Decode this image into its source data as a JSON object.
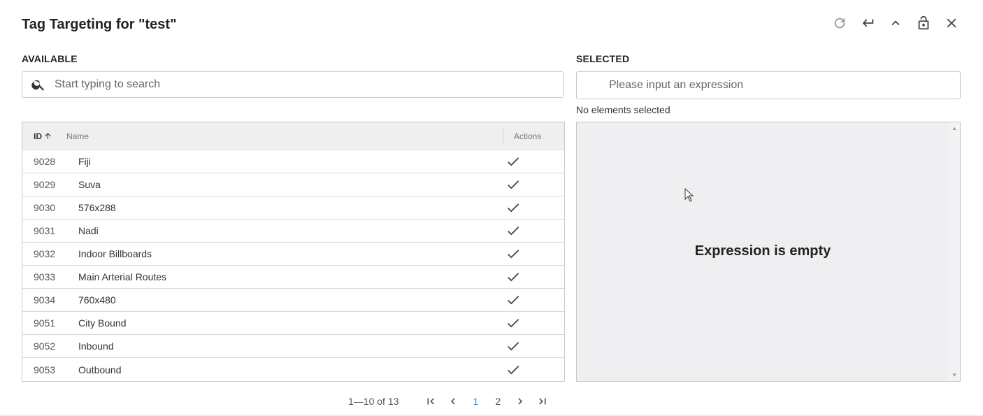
{
  "dialog": {
    "title": "Tag Targeting for \"test\""
  },
  "header_icons": [
    "refresh-icon",
    "enter-icon",
    "collapse-icon",
    "unlock-icon",
    "close-icon"
  ],
  "available": {
    "label": "AVAILABLE",
    "search_placeholder": "Start typing to search",
    "columns": {
      "id": "ID",
      "name": "Name",
      "actions": "Actions"
    },
    "rows": [
      {
        "id": "9028",
        "name": "Fiji"
      },
      {
        "id": "9029",
        "name": "Suva"
      },
      {
        "id": "9030",
        "name": "576x288"
      },
      {
        "id": "9031",
        "name": "Nadi"
      },
      {
        "id": "9032",
        "name": "Indoor Billboards"
      },
      {
        "id": "9033",
        "name": "Main Arterial Routes"
      },
      {
        "id": "9034",
        "name": "760x480"
      },
      {
        "id": "9051",
        "name": "City Bound"
      },
      {
        "id": "9052",
        "name": "Inbound"
      },
      {
        "id": "9053",
        "name": "Outbound"
      }
    ]
  },
  "selected": {
    "label": "SELECTED",
    "expression_placeholder": "Please input an expression",
    "status": "No elements selected",
    "empty_message": "Expression is empty"
  },
  "pagination": {
    "range": "1—10 of 13",
    "pages": [
      "1",
      "2"
    ],
    "current_page": "1"
  },
  "colors": {
    "accent": "#3b8fd9",
    "panel_bg": "#efeff1"
  }
}
